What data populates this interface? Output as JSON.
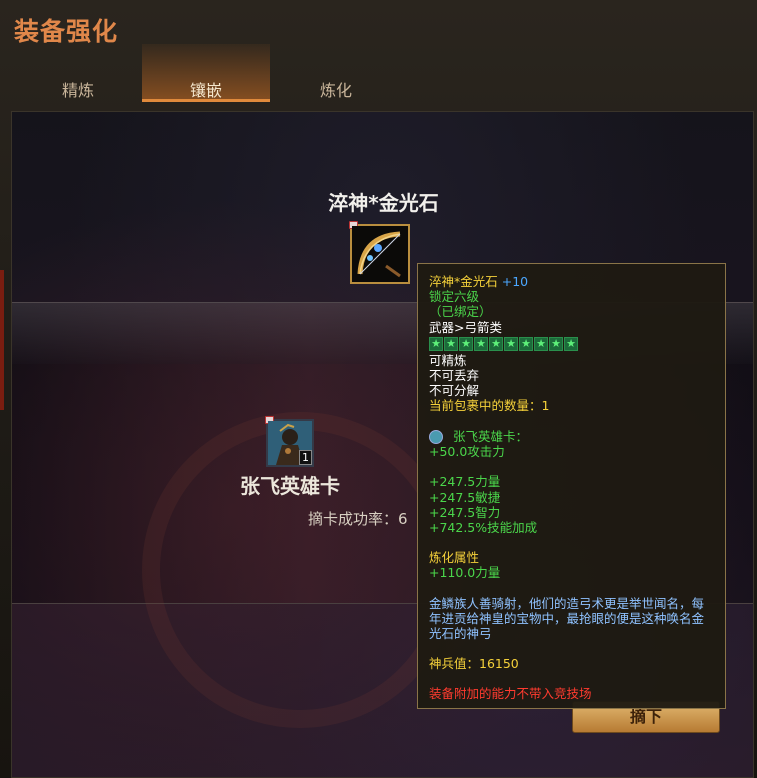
{
  "window": {
    "title": "装备强化"
  },
  "tabs": [
    {
      "label": "精炼",
      "active": false
    },
    {
      "label": "镶嵌",
      "active": true
    },
    {
      "label": "炼化",
      "active": false
    }
  ],
  "equipment": {
    "name": "淬神*金光石",
    "icon": "bow-icon",
    "locked": true
  },
  "card": {
    "name": "张飞英雄卡",
    "count": "1",
    "icon": "hero-card-icon",
    "locked": true
  },
  "remove_rate_label": "摘卡成功率：6",
  "remove_button": "摘下",
  "tooltip": {
    "name": "淬神*金光石",
    "plus": "+10",
    "lock_level": "锁定六级",
    "bound": "（已绑定）",
    "category": "武器>弓箭类",
    "stars": 10,
    "props": [
      "可精炼",
      "不可丢弃",
      "不可分解"
    ],
    "bag_count": "当前包裹中的数量：1",
    "card_title": "张飞英雄卡：",
    "card_bonus": "+50.0攻击力",
    "stats": [
      "+247.5力量",
      "+247.5敏捷",
      "+247.5智力",
      "+742.5%技能加成"
    ],
    "refine_title": "炼化属性",
    "refine_value": "+110.0力量",
    "description": "金鳞族人善骑射，他们的造弓术更是举世闻名，每年进贡给神皇的宝物中，最抢眼的便是这种唤名金光石的神弓",
    "divine_value": "神兵值：16150",
    "warning": "装备附加的能力不带入竞技场"
  },
  "colors": {
    "title": "#e0874a",
    "tab_active": "#e08a3c",
    "tooltip_yellow": "#f5d13a",
    "tooltip_green": "#4bd64b",
    "tooltip_blue": "#4ba7ff",
    "tooltip_red": "#ff3b2f",
    "button": "#d4a55a"
  }
}
